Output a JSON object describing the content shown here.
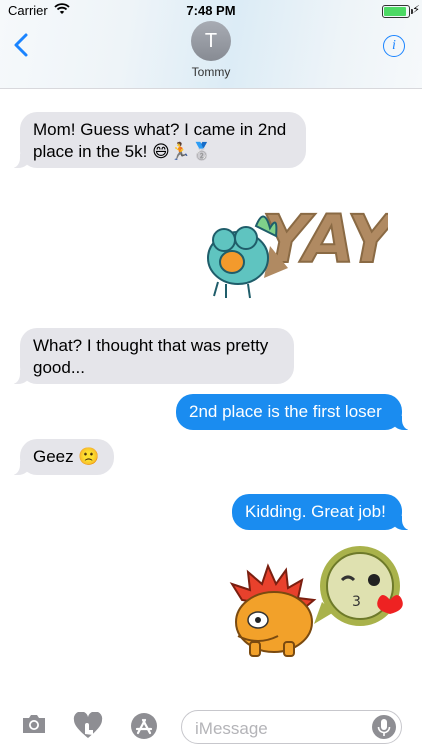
{
  "status_bar": {
    "carrier": "Carrier",
    "time": "7:48 PM",
    "battery_percent": 90
  },
  "header": {
    "avatar_initial": "T",
    "contact_name": "Tommy",
    "back_icon": "chevron-left-icon",
    "info_icon": "info-icon"
  },
  "messages": [
    {
      "from": "contact",
      "text_line1": "Mom! Guess what? I came in 2nd",
      "text_line2": "place in the 5k! 😄🏃🥈"
    },
    {
      "from": "me",
      "type": "sticker",
      "sticker_text": "YAY"
    },
    {
      "from": "contact",
      "text_line1": "What? I thought that was pretty",
      "text_line2": "good..."
    },
    {
      "from": "me",
      "text": "2nd place is the first loser"
    },
    {
      "from": "contact",
      "text": "Geez 🙁"
    },
    {
      "from": "me",
      "text": "Kidding. Great job!"
    },
    {
      "from": "me",
      "type": "sticker",
      "sticker_text": ""
    }
  ],
  "input_bar": {
    "placeholder": "iMessage",
    "icons": [
      "camera-icon",
      "heart-touch-icon",
      "app-store-icon",
      "microphone-icon"
    ]
  },
  "colors": {
    "outgoing_bubble": "#1a8cf0",
    "incoming_bubble": "#e5e5ea",
    "accent": "#1a84ff"
  }
}
